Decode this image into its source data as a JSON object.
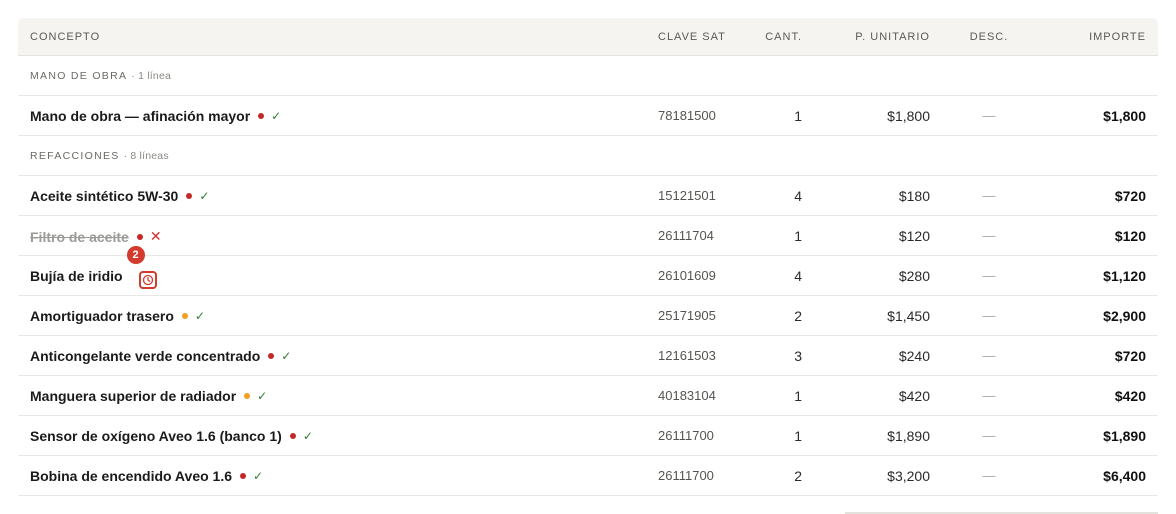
{
  "columns": {
    "concepto": "CONCEPTO",
    "clave": "CLAVE SAT",
    "cant": "CANT.",
    "unitario": "P. UNITARIO",
    "desc": "DESC.",
    "importe": "IMPORTE"
  },
  "groups": [
    {
      "label": "MANO DE OBRA",
      "count": "· 1 línea",
      "items": [
        {
          "name": "Mano de obra — afinación mayor",
          "dot": "red",
          "mark": "✓",
          "clave": "78181500",
          "cant": "1",
          "unit": "$1,800",
          "desc": "—",
          "importe": "$1,800"
        }
      ]
    },
    {
      "label": "REFACCIONES",
      "count": "· 8 líneas",
      "items": [
        {
          "name": "Aceite sintético 5W-30",
          "dot": "red",
          "mark": "✓",
          "clave": "15121501",
          "cant": "4",
          "unit": "$180",
          "desc": "—",
          "importe": "$720"
        },
        {
          "name": "Filtro de aceite",
          "dot": "red",
          "mark": "✕",
          "clave": "26111704",
          "cant": "1",
          "unit": "$120",
          "desc": "—",
          "importe": "$120"
        },
        {
          "name": "Bujía de iridio",
          "badge": "2",
          "clave": "26101609",
          "cant": "4",
          "unit": "$280",
          "desc": "—",
          "importe": "$1,120"
        },
        {
          "name": "Amortiguador trasero",
          "dot": "orange",
          "mark": "✓",
          "clave": "25171905",
          "cant": "2",
          "unit": "$1,450",
          "desc": "—",
          "importe": "$2,900"
        },
        {
          "name": "Anticongelante verde concentrado",
          "dot": "red",
          "mark": "✓",
          "clave": "12161503",
          "cant": "3",
          "unit": "$240",
          "desc": "—",
          "importe": "$720"
        },
        {
          "name": "Manguera superior de radiador",
          "dot": "orange",
          "mark": "✓",
          "clave": "40183104",
          "cant": "1",
          "unit": "$420",
          "desc": "—",
          "importe": "$420"
        },
        {
          "name": "Sensor de oxígeno Aveo 1.6 (banco 1)",
          "dot": "red",
          "mark": "✓",
          "clave": "26111700",
          "cant": "1",
          "unit": "$1,890",
          "desc": "—",
          "importe": "$1,890"
        },
        {
          "name": "Bobina de encendido Aveo 1.6",
          "dot": "red",
          "mark": "✓",
          "clave": "26111700",
          "cant": "2",
          "unit": "$3,200",
          "desc": "—",
          "importe": "$6,400"
        }
      ]
    }
  ],
  "colors": {
    "dot_red": "#c62828",
    "dot_orange": "#f1a01c",
    "check": "#2e7d32",
    "cross": "#d32f2f",
    "badge": "#d23b2e"
  },
  "icons": {
    "approved": "check-icon",
    "rejected": "cross-icon",
    "pending": "clock-icon",
    "status": "status-dot-icon"
  }
}
